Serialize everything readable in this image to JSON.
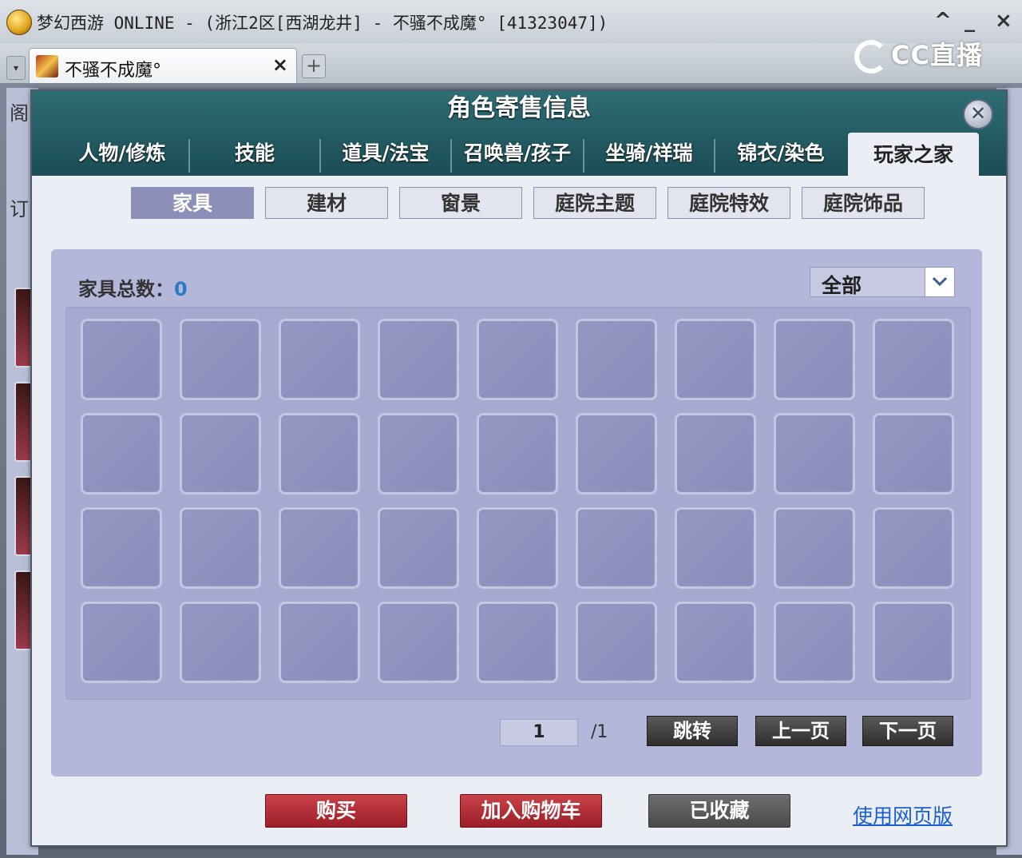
{
  "window": {
    "title": "梦幻西游 ONLINE - (浙江2区[西湖龙井] - 不骚不成魔° [41323047])",
    "controls": [
      "^",
      "_",
      "×"
    ]
  },
  "browser_tab": {
    "label": "不骚不成魔°",
    "close": "×",
    "add": "+",
    "menu": "▾"
  },
  "overlay_logo": "CC直播",
  "background": {
    "left_chars": [
      "阁",
      "订"
    ]
  },
  "dialog": {
    "title": "角色寄售信息",
    "close": "✕",
    "main_tabs": [
      "人物/修炼",
      "技能",
      "道具/法宝",
      "召唤兽/孩子",
      "坐骑/祥瑞",
      "锦衣/染色",
      "玩家之家"
    ],
    "active_main_tab": "玩家之家",
    "sub_tabs": [
      "家具",
      "建材",
      "窗景",
      "庭院主题",
      "庭院特效",
      "庭院饰品"
    ],
    "active_sub_tab": "家具",
    "count_label": "家具总数：",
    "count_value": "0",
    "filter_value": "全部",
    "pager": {
      "current": "1",
      "total": "/1",
      "jump": "跳转",
      "prev": "上一页",
      "next": "下一页"
    },
    "actions": {
      "buy": "购买",
      "add_cart": "加入购物车",
      "favorited": "已收藏",
      "web_version": "使用网页版"
    }
  },
  "colors": {
    "dialog_header": "#1b4c55",
    "panel": "#b4b7da",
    "count_value": "#2a7bc4",
    "buy_red": "#9d1e28",
    "link": "#1a5fd1"
  }
}
